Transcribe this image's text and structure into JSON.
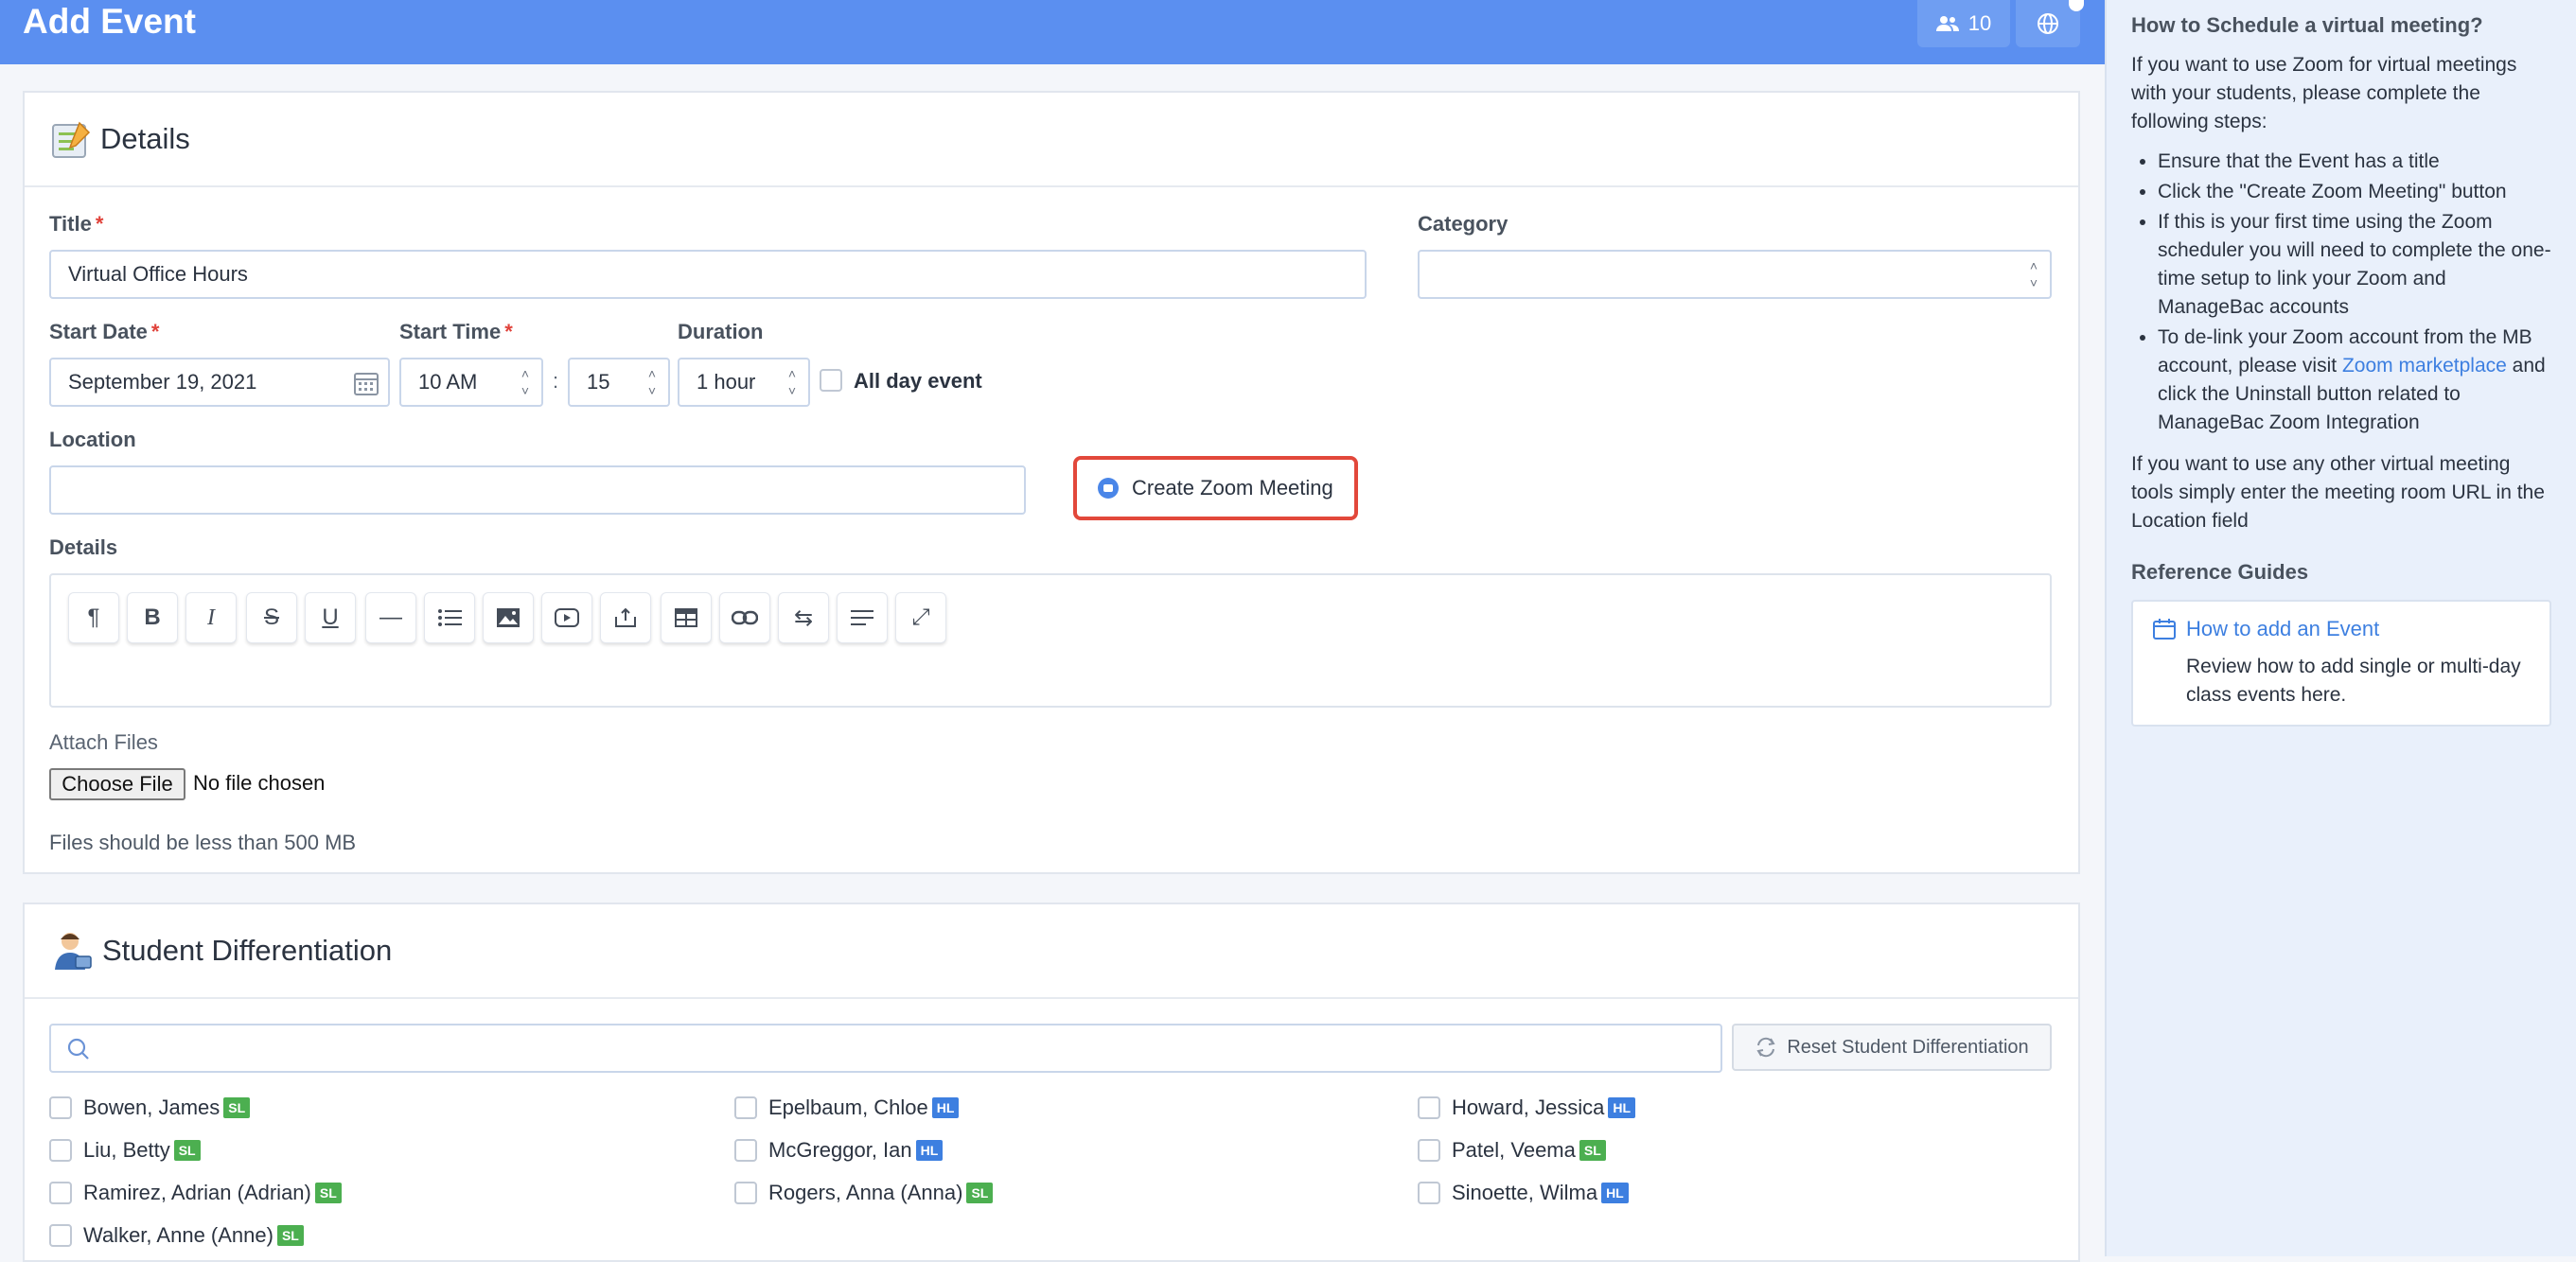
{
  "header": {
    "title": "Add Event",
    "users_count": "10"
  },
  "details": {
    "section_title": "Details",
    "title_label": "Title",
    "title_value": "Virtual Office Hours",
    "category_label": "Category",
    "category_value": "",
    "start_date_label": "Start Date",
    "start_date_value": "September 19, 2021",
    "start_time_label": "Start Time",
    "start_hour_value": "10 AM",
    "time_separator": ":",
    "start_minute_value": "15",
    "duration_label": "Duration",
    "duration_value": "1 hour",
    "all_day_label": "All day event",
    "location_label": "Location",
    "location_value": "",
    "zoom_button_label": "Create Zoom Meeting",
    "details_label": "Details",
    "toolbar": [
      "paragraph",
      "bold",
      "italic",
      "strikethrough",
      "underline",
      "horizontal-line",
      "list",
      "image",
      "video",
      "embed",
      "table",
      "link",
      "direction",
      "align",
      "fullscreen"
    ],
    "attach_label": "Attach Files",
    "choose_file_label": "Choose File",
    "no_file_label": "No file chosen",
    "file_note": "Files should be less than 500 MB"
  },
  "differentiation": {
    "section_title": "Student Differentiation",
    "search_placeholder": "",
    "reset_label": "Reset Student Differentiation",
    "students": [
      {
        "name": "Bowen, James",
        "level": "SL"
      },
      {
        "name": "Epelbaum, Chloe",
        "level": "HL"
      },
      {
        "name": "Howard, Jessica",
        "level": "HL"
      },
      {
        "name": "Liu, Betty",
        "level": "SL"
      },
      {
        "name": "McGreggor, Ian",
        "level": "HL"
      },
      {
        "name": "Patel, Veema",
        "level": "SL"
      },
      {
        "name": "Ramirez, Adrian (Adrian)",
        "level": "SL"
      },
      {
        "name": "Rogers, Anna (Anna)",
        "level": "SL"
      },
      {
        "name": "Sinoette, Wilma",
        "level": "HL"
      },
      {
        "name": "Walker, Anne (Anne)",
        "level": "SL"
      }
    ]
  },
  "sidebar": {
    "heading": "How to Schedule a virtual meeting?",
    "intro": "If you want to use Zoom for virtual meetings with your students, please complete the following steps:",
    "step1": "Ensure that the Event has a title",
    "step2": "Click the \"Create Zoom Meeting\" button",
    "step3": "If this is your first time using the Zoom scheduler you will need to complete the one-time setup to link your Zoom and ManageBac accounts",
    "step4_a": "To de-link your Zoom account from the MB account, please visit ",
    "step4_link": "Zoom marketplace",
    "step4_b": " and click the Uninstall button related to ManageBac Zoom Integration",
    "other_tools": "If you want to use any other virtual meeting tools simply enter the meeting room URL in the Location field",
    "ref_heading": "Reference Guides",
    "ref_link": "How to add an Event",
    "ref_desc": "Review how to add single or multi-day class events here."
  }
}
